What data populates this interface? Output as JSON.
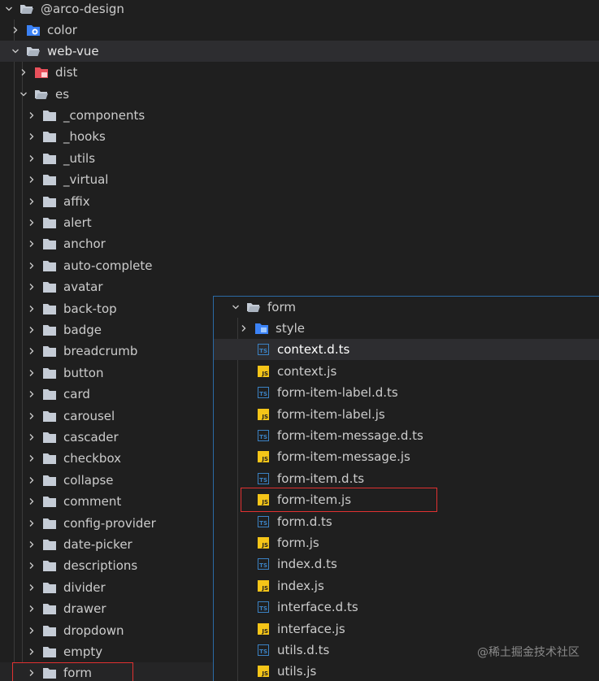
{
  "tree": {
    "root": {
      "label": "@arco-design",
      "icon": "folder-open-icon",
      "expanded": true
    },
    "color": {
      "label": "color",
      "icon": "folder-color-icon",
      "expanded": false
    },
    "web_vue": {
      "label": "web-vue",
      "icon": "folder-open-icon",
      "expanded": true
    },
    "dist": {
      "label": "dist",
      "icon": "folder-dist-icon",
      "expanded": false
    },
    "es": {
      "label": "es",
      "icon": "folder-open-icon",
      "expanded": true
    },
    "es_children": [
      "_components",
      "_hooks",
      "_utils",
      "_virtual",
      "affix",
      "alert",
      "anchor",
      "auto-complete",
      "avatar",
      "back-top",
      "badge",
      "breadcrumb",
      "button",
      "card",
      "carousel",
      "cascader",
      "checkbox",
      "collapse",
      "comment",
      "config-provider",
      "date-picker",
      "descriptions",
      "divider",
      "drawer",
      "dropdown",
      "empty",
      "form"
    ]
  },
  "overlay": {
    "folder": {
      "label": "form",
      "icon": "folder-open-icon",
      "expanded": true
    },
    "items": [
      {
        "label": "style",
        "type": "folder"
      },
      {
        "label": "context.d.ts",
        "type": "ts"
      },
      {
        "label": "context.js",
        "type": "js"
      },
      {
        "label": "form-item-label.d.ts",
        "type": "ts"
      },
      {
        "label": "form-item-label.js",
        "type": "js"
      },
      {
        "label": "form-item-message.d.ts",
        "type": "ts"
      },
      {
        "label": "form-item-message.js",
        "type": "js"
      },
      {
        "label": "form-item.d.ts",
        "type": "ts"
      },
      {
        "label": "form-item.js",
        "type": "js"
      },
      {
        "label": "form.d.ts",
        "type": "ts"
      },
      {
        "label": "form.js",
        "type": "js"
      },
      {
        "label": "index.d.ts",
        "type": "ts"
      },
      {
        "label": "index.js",
        "type": "js"
      },
      {
        "label": "interface.d.ts",
        "type": "ts"
      },
      {
        "label": "interface.js",
        "type": "js"
      },
      {
        "label": "utils.d.ts",
        "type": "ts"
      },
      {
        "label": "utils.js",
        "type": "js"
      }
    ]
  },
  "badges": {
    "ts": "TS",
    "js": "JS"
  },
  "colors": {
    "background": "#1f1f1f",
    "text": "#cccccc",
    "folder": "#c5ccd6",
    "ts": "#3b82c4",
    "js": "#f5c518",
    "highlight": "#e03131",
    "overlay_border": "#2b6aa5"
  },
  "watermark": "@稀土掘金技术社区"
}
